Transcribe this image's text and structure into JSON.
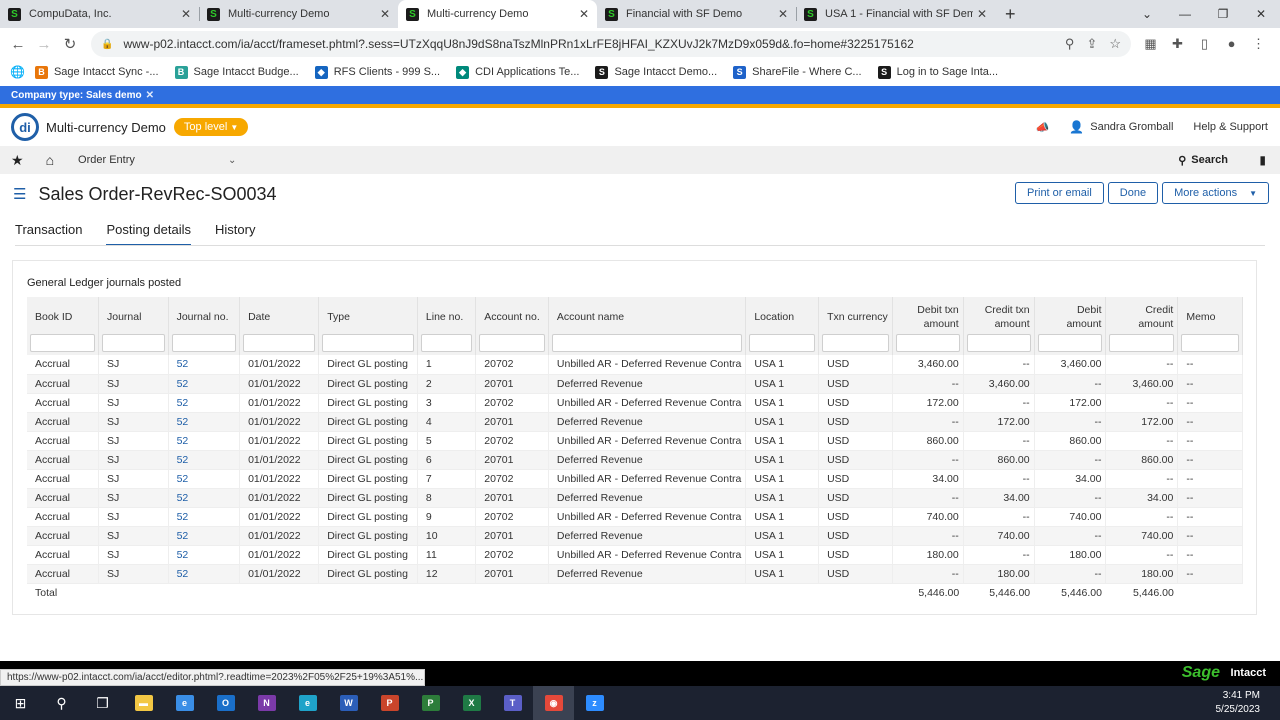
{
  "browser": {
    "tabs": [
      {
        "title": "CompuData, Inc.",
        "active": false
      },
      {
        "title": "Multi-currency Demo",
        "active": false
      },
      {
        "title": "Multi-currency Demo",
        "active": true
      },
      {
        "title": "Financial with SF Demo",
        "active": false
      },
      {
        "title": "USA 1 - Financial with SF Demo",
        "active": false
      }
    ],
    "url": "www-p02.intacct.com/ia/acct/frameset.phtml?.sess=UTzXqqU8nJ9dS8naTszMlnPRn1xLrFE8jHFAI_KZXUvJ2k7MzD9x059d&.fo=home#3225175162",
    "bookmarks": [
      {
        "label": "Sage Intacct Sync -...",
        "color": "#e8760a",
        "glyph": "B"
      },
      {
        "label": "Sage Intacct Budge...",
        "color": "#2aa198",
        "glyph": "B"
      },
      {
        "label": "RFS Clients - 999 S...",
        "color": "#1565c0",
        "glyph": "◆"
      },
      {
        "label": "CDI Applications Te...",
        "color": "#00897b",
        "glyph": "◆"
      },
      {
        "label": "Sage Intacct Demo...",
        "color": "#1b1b1b",
        "glyph": "S"
      },
      {
        "label": "ShareFile - Where C...",
        "color": "#1e62c9",
        "glyph": "S"
      },
      {
        "label": "Log in to Sage Inta...",
        "color": "#1b1b1b",
        "glyph": "S"
      }
    ],
    "status_url": "https://www-p02.intacct.com/ia/acct/editor.phtml?.readtime=2023%2F05%2F25+19%3A51%..."
  },
  "app": {
    "company_type": "Company type: Sales demo",
    "company_name": "Multi-currency Demo",
    "level": "Top level",
    "user": "Sandra Gromball",
    "help": "Help & Support",
    "module": "Order Entry",
    "search": "Search",
    "page_title": "Sales Order-RevRec-SO0034",
    "actions": {
      "print": "Print or email",
      "done": "Done",
      "more": "More actions"
    },
    "tabs": [
      "Transaction",
      "Posting details",
      "History"
    ],
    "active_tab": "Posting details",
    "footer_brand": "Sage",
    "footer_product": "Intacct"
  },
  "journal": {
    "title": "General Ledger journals posted",
    "columns": [
      "Book ID",
      "Journal",
      "Journal no.",
      "Date",
      "Type",
      "Line no.",
      "Account no.",
      "Account name",
      "Location",
      "Txn currency",
      "Debit txn amount",
      "Credit txn amount",
      "Debit amount",
      "Credit amount",
      "Memo"
    ],
    "rows": [
      [
        "Accrual",
        "SJ",
        "52",
        "01/01/2022",
        "Direct GL posting",
        "1",
        "20702",
        "Unbilled AR - Deferred Revenue Contra",
        "USA 1",
        "USD",
        "3,460.00",
        "--",
        "3,460.00",
        "--",
        "--"
      ],
      [
        "Accrual",
        "SJ",
        "52",
        "01/01/2022",
        "Direct GL posting",
        "2",
        "20701",
        "Deferred Revenue",
        "USA 1",
        "USD",
        "--",
        "3,460.00",
        "--",
        "3,460.00",
        "--"
      ],
      [
        "Accrual",
        "SJ",
        "52",
        "01/01/2022",
        "Direct GL posting",
        "3",
        "20702",
        "Unbilled AR - Deferred Revenue Contra",
        "USA 1",
        "USD",
        "172.00",
        "--",
        "172.00",
        "--",
        "--"
      ],
      [
        "Accrual",
        "SJ",
        "52",
        "01/01/2022",
        "Direct GL posting",
        "4",
        "20701",
        "Deferred Revenue",
        "USA 1",
        "USD",
        "--",
        "172.00",
        "--",
        "172.00",
        "--"
      ],
      [
        "Accrual",
        "SJ",
        "52",
        "01/01/2022",
        "Direct GL posting",
        "5",
        "20702",
        "Unbilled AR - Deferred Revenue Contra",
        "USA 1",
        "USD",
        "860.00",
        "--",
        "860.00",
        "--",
        "--"
      ],
      [
        "Accrual",
        "SJ",
        "52",
        "01/01/2022",
        "Direct GL posting",
        "6",
        "20701",
        "Deferred Revenue",
        "USA 1",
        "USD",
        "--",
        "860.00",
        "--",
        "860.00",
        "--"
      ],
      [
        "Accrual",
        "SJ",
        "52",
        "01/01/2022",
        "Direct GL posting",
        "7",
        "20702",
        "Unbilled AR - Deferred Revenue Contra",
        "USA 1",
        "USD",
        "34.00",
        "--",
        "34.00",
        "--",
        "--"
      ],
      [
        "Accrual",
        "SJ",
        "52",
        "01/01/2022",
        "Direct GL posting",
        "8",
        "20701",
        "Deferred Revenue",
        "USA 1",
        "USD",
        "--",
        "34.00",
        "--",
        "34.00",
        "--"
      ],
      [
        "Accrual",
        "SJ",
        "52",
        "01/01/2022",
        "Direct GL posting",
        "9",
        "20702",
        "Unbilled AR - Deferred Revenue Contra",
        "USA 1",
        "USD",
        "740.00",
        "--",
        "740.00",
        "--",
        "--"
      ],
      [
        "Accrual",
        "SJ",
        "52",
        "01/01/2022",
        "Direct GL posting",
        "10",
        "20701",
        "Deferred Revenue",
        "USA 1",
        "USD",
        "--",
        "740.00",
        "--",
        "740.00",
        "--"
      ],
      [
        "Accrual",
        "SJ",
        "52",
        "01/01/2022",
        "Direct GL posting",
        "11",
        "20702",
        "Unbilled AR - Deferred Revenue Contra",
        "USA 1",
        "USD",
        "180.00",
        "--",
        "180.00",
        "--",
        "--"
      ],
      [
        "Accrual",
        "SJ",
        "52",
        "01/01/2022",
        "Direct GL posting",
        "12",
        "20701",
        "Deferred Revenue",
        "USA 1",
        "USD",
        "--",
        "180.00",
        "--",
        "180.00",
        "--"
      ]
    ],
    "total_label": "Total",
    "totals": {
      "debit_txn": "5,446.00",
      "credit_txn": "5,446.00",
      "debit": "5,446.00",
      "credit": "5,446.00"
    }
  },
  "taskbar": {
    "apps": [
      {
        "name": "start-icon",
        "glyph": "⊞",
        "color": "#ffffff"
      },
      {
        "name": "search-icon",
        "glyph": "⚲",
        "color": "#ffffff"
      },
      {
        "name": "task-view-icon",
        "glyph": "❐",
        "color": "#ffffff"
      },
      {
        "name": "file-explorer-icon",
        "glyph": "▬",
        "color": "#f2c744"
      },
      {
        "name": "ie-icon",
        "glyph": "e",
        "color": "#3a8ee6"
      },
      {
        "name": "outlook-icon",
        "glyph": "O",
        "color": "#1a6fc9"
      },
      {
        "name": "onenote-icon",
        "glyph": "N",
        "color": "#7b3aa8"
      },
      {
        "name": "edge-icon",
        "glyph": "e",
        "color": "#1fa3c9"
      },
      {
        "name": "word-icon",
        "glyph": "W",
        "color": "#2b5eb8"
      },
      {
        "name": "powerpoint-icon",
        "glyph": "P",
        "color": "#c9452b"
      },
      {
        "name": "project-icon",
        "glyph": "P",
        "color": "#2d7d3a"
      },
      {
        "name": "excel-icon",
        "glyph": "X",
        "color": "#1f7a45"
      },
      {
        "name": "teams-icon",
        "glyph": "T",
        "color": "#5b5fc7"
      },
      {
        "name": "chrome-icon",
        "glyph": "◉",
        "color": "#e5493a"
      },
      {
        "name": "zoom-icon",
        "glyph": "z",
        "color": "#2d8cff"
      }
    ],
    "time": "3:41 PM",
    "date": "5/25/2023"
  }
}
